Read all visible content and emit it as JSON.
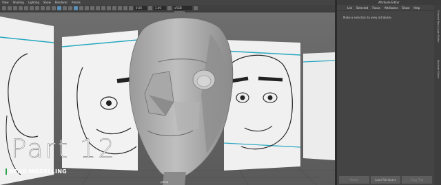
{
  "menubar": {
    "items": [
      "View",
      "Shading",
      "Lighting",
      "Show",
      "Renderer",
      "Panels"
    ]
  },
  "toolbar": {
    "field_a": "0.00",
    "field_b": "1.00",
    "colorspace": "sRGB gamma"
  },
  "viewport": {
    "camera_label": "persp"
  },
  "overlay": {
    "title": "Part 12",
    "subtitle": "HEAD MODELLING",
    "accent_color": "#2ea44f"
  },
  "attribute_editor": {
    "title": "Attribute Editor",
    "menu": [
      "List",
      "Selected",
      "Focus",
      "Attributes",
      "Show",
      "Help"
    ],
    "message": "Make a selection to view attributes",
    "buttons": [
      "Select",
      "Load Attributes",
      "Copy Tab"
    ],
    "side_tabs": [
      "Attribute Editor",
      "Channel Box / Layer Editor"
    ]
  }
}
